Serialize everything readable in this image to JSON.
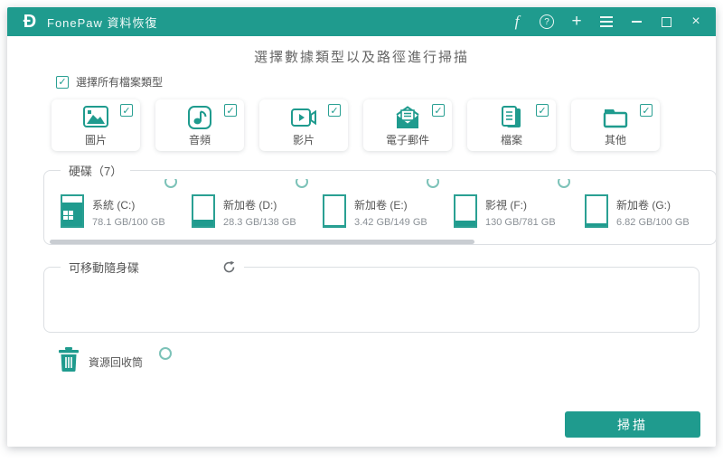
{
  "titlebar": {
    "title": "FonePaw 資料恢復",
    "logo_glyph": "Ð",
    "facebook_glyph": "f",
    "help_glyph": "?",
    "plus_glyph": "+",
    "close_glyph": "×"
  },
  "glyphs": {
    "check": "✓"
  },
  "header": {
    "heading": "選擇數據類型以及路徑進行掃描"
  },
  "select_all": {
    "label": "選擇所有檔案類型",
    "checked": true
  },
  "file_types": [
    {
      "label": "圖片",
      "icon": "image-icon",
      "checked": true
    },
    {
      "label": "音頻",
      "icon": "audio-icon",
      "checked": true
    },
    {
      "label": "影片",
      "icon": "video-icon",
      "checked": true
    },
    {
      "label": "電子郵件",
      "icon": "email-icon",
      "checked": true
    },
    {
      "label": "檔案",
      "icon": "document-icon",
      "checked": true
    },
    {
      "label": "其他",
      "icon": "folder-icon",
      "checked": true
    }
  ],
  "drives_section": {
    "legend": "硬碟（7）",
    "drives": [
      {
        "name": "系統 (C:)",
        "size": "78.1 GB/100 GB",
        "fill_percent": 78,
        "selected": false
      },
      {
        "name": "新加卷 (D:)",
        "size": "28.3 GB/138 GB",
        "fill_percent": 20,
        "selected": false
      },
      {
        "name": "新加卷 (E:)",
        "size": "3.42 GB/149 GB",
        "fill_percent": 4,
        "selected": false
      },
      {
        "name": "影視 (F:)",
        "size": "130 GB/781 GB",
        "fill_percent": 17,
        "selected": false
      },
      {
        "name": "新加卷 (G:)",
        "size": "6.82 GB/100 GB",
        "fill_percent": 8,
        "selected": true
      }
    ]
  },
  "removable_section": {
    "legend": "可移動隨身碟"
  },
  "recycle_bin": {
    "label": "資源回收筒"
  },
  "scan": {
    "label": "掃描"
  },
  "colors": {
    "accent": "#1F9B8E"
  }
}
